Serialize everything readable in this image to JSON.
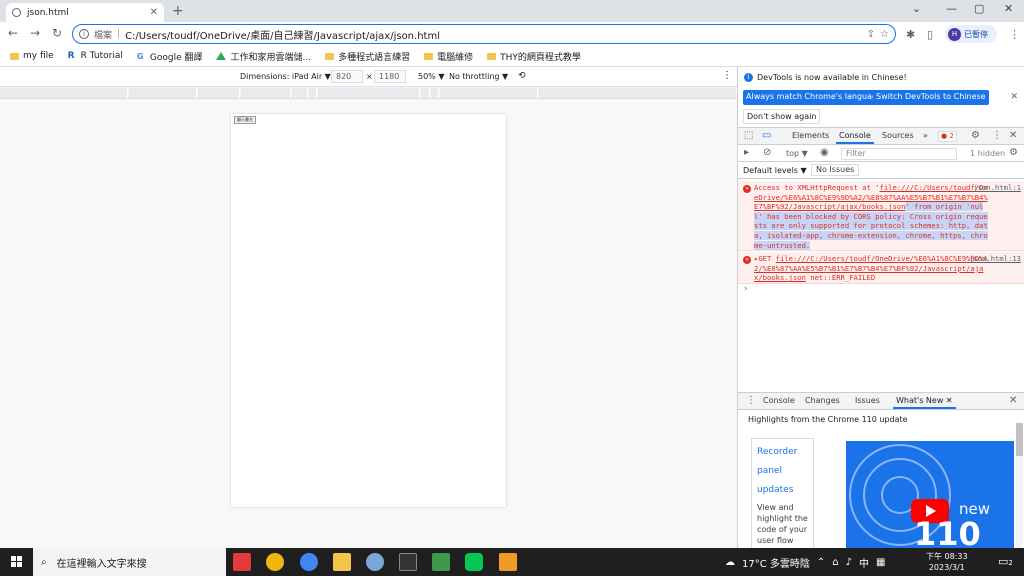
{
  "tab": {
    "title": "json.html",
    "close": "✕",
    "new": "+"
  },
  "window": {
    "min": "⌄",
    "min2": "—",
    "max": "▢",
    "close": "✕"
  },
  "toolbar": {
    "back": "←",
    "forward": "→",
    "reload": "↻",
    "scheme": "檔案",
    "separator": "|",
    "url": "C:/Users/toudf/OneDrive/桌面/自己練習/Javascript/ajax/json.html",
    "share_icon": "⇪",
    "star_icon": "☆",
    "ext_icon": "✱",
    "side_icon": "▯",
    "profile_initial": "H",
    "profile_label": "已暫停",
    "menu_icon": "⋮"
  },
  "bookmarks": [
    {
      "label": "my file",
      "icon": "folder"
    },
    {
      "label": "R Tutorial",
      "icon": "r"
    },
    {
      "label": "Google 翻譯",
      "icon": "g"
    },
    {
      "label": "工作和家用雲端儲...",
      "icon": "drive"
    },
    {
      "label": "多種程式語言練習",
      "icon": "folder"
    },
    {
      "label": "電腦維修",
      "icon": "folder"
    },
    {
      "label": "THY的網頁程式教學",
      "icon": "folder"
    }
  ],
  "device_toolbar": {
    "dimensions": "Dimensions: iPad Air ▼",
    "width": "820",
    "times": "×",
    "height": "1180",
    "zoom": "50% ▼",
    "throttling": "No throttling ▼",
    "rotate": "⟲",
    "menu": "⋮"
  },
  "page": {
    "button": "顯示書名"
  },
  "devtools": {
    "notice": "DevTools is now available in Chinese!",
    "btn_match": "Always match Chrome's language",
    "btn_switch": "Switch DevTools to Chinese",
    "btn_dontshow": "Don't show again",
    "notice_close": "✕",
    "tabs": {
      "elements": "Elements",
      "console": "Console",
      "sources": "Sources",
      "more": "»"
    },
    "error_count": "2",
    "filter_placeholder": "Filter",
    "top": "top ▼",
    "hidden": "1 hidden",
    "default_levels": "Default levels ▼",
    "no_issues": "No Issues",
    "error1": {
      "pre": "Access to XMLHttpRequest at '",
      "link": "file:///C:/Users/toudf/OneDrive/%E6%A1%8C%E9%9D%A2/%E8%87%AA%E5%B7%B1%E7%B7%B4%E7%BF%92/Javascript/ajax/books.json",
      "mid": "' from origin 'null' has been blocked by CORS policy: Cross origin requests are only supported for protocol schemes: http, data, isolated-app, chrome-extension, chrome, https, chrome-untrusted.",
      "source": "json.html:1"
    },
    "error2": {
      "pre": "▸GET ",
      "link": "file:///C:/Users/toudf/OneDrive/%E6%A1%8C%E9%9D%A2/%E8%87%AA%E5%B7%B1%E7%B7%B4%E7%BF%92/Javascript/ajax/books.json",
      "suffix": " net::ERR_FAILED",
      "source": "json.html:13"
    },
    "prompt": "›",
    "drawer_tabs": {
      "console": "Console",
      "changes": "Changes",
      "issues": "Issues",
      "whatsnew": "What's New ✕"
    },
    "whatsnew_head": "Highlights from the Chrome 110 update",
    "card_title_1": "Recorder",
    "card_title_2": "panel",
    "card_title_3": "updates",
    "card_desc": "View and highlight the code of your user flow instantly, and",
    "image_new": "new",
    "image_num": "110"
  },
  "taskbar": {
    "search": "在這裡輸入文字來搜",
    "weather": "17°C 多雲時陰",
    "ime": "中",
    "time": "下午 08:33",
    "date": "2023/3/1",
    "notif_count": "2"
  },
  "colors": {
    "accent": "#1a73e8",
    "error": "#d93025",
    "error_bg": "#fff0f0"
  }
}
